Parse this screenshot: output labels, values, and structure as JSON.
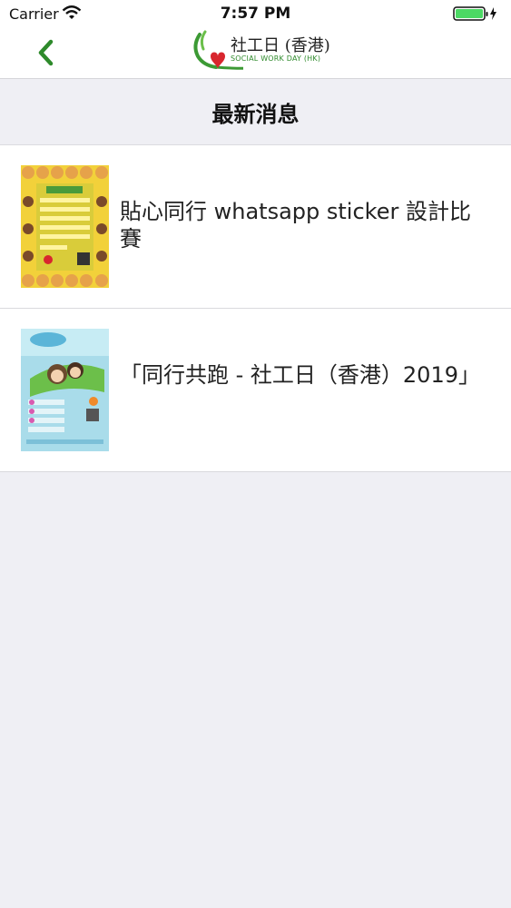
{
  "status_bar": {
    "carrier": "Carrier",
    "time": "7:57 PM"
  },
  "nav": {
    "logo_title": "社工日 (香港)",
    "logo_subtitle": "SOCIAL WORK DAY (HK)"
  },
  "section": {
    "title": "最新消息"
  },
  "news": [
    {
      "title": "貼心同行 whatsapp sticker 設計比賽"
    },
    {
      "title": "「同行共跑 - 社工日（香港）2019」"
    }
  ],
  "colors": {
    "brand_green": "#2e8a2b",
    "heart_red": "#d8262e",
    "background": "#efeff4"
  }
}
